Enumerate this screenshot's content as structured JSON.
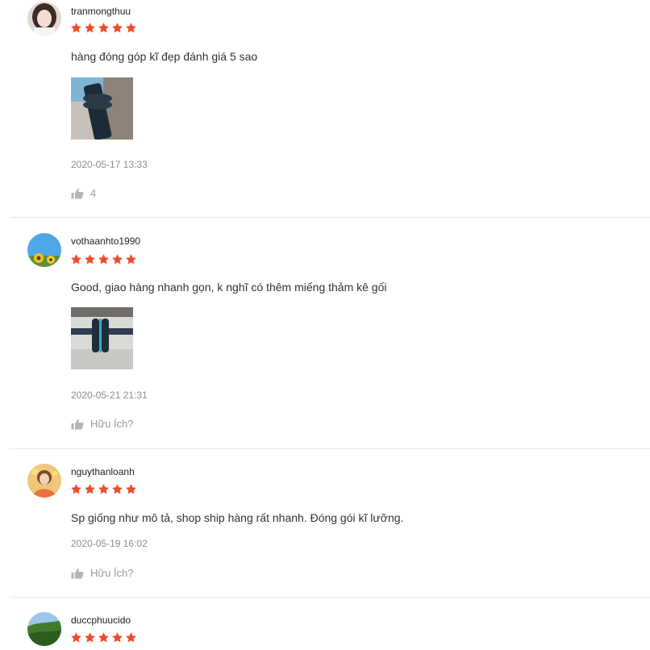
{
  "colors": {
    "star": "#ee4d2d",
    "username": "#222222",
    "text": "#333333",
    "muted": "#8f8f8f",
    "divider": "#e8e8e8"
  },
  "reviews": [
    {
      "username": "tranmongthuu",
      "rating": 5,
      "comment": "hàng đóng góp kĩ đẹp đánh giá 5 sao",
      "datetime": "2020-05-17 13:33",
      "like_label": "4"
    },
    {
      "username": "vothaanhto1990",
      "rating": 5,
      "comment": "Good, giao hàng nhanh gọn, k nghĩ có thêm miếng thảm kê gối",
      "datetime": "2020-05-21 21:31",
      "like_label": "Hữu Ích?"
    },
    {
      "username": "nguythanloanh",
      "rating": 5,
      "comment": "Sp giống như mô tả, shop ship hàng rất nhanh. Đóng gói kĩ lưỡng.",
      "datetime": "2020-05-19 16:02",
      "like_label": "Hữu Ích?"
    },
    {
      "username": "duccphuucido",
      "rating": 5
    }
  ]
}
